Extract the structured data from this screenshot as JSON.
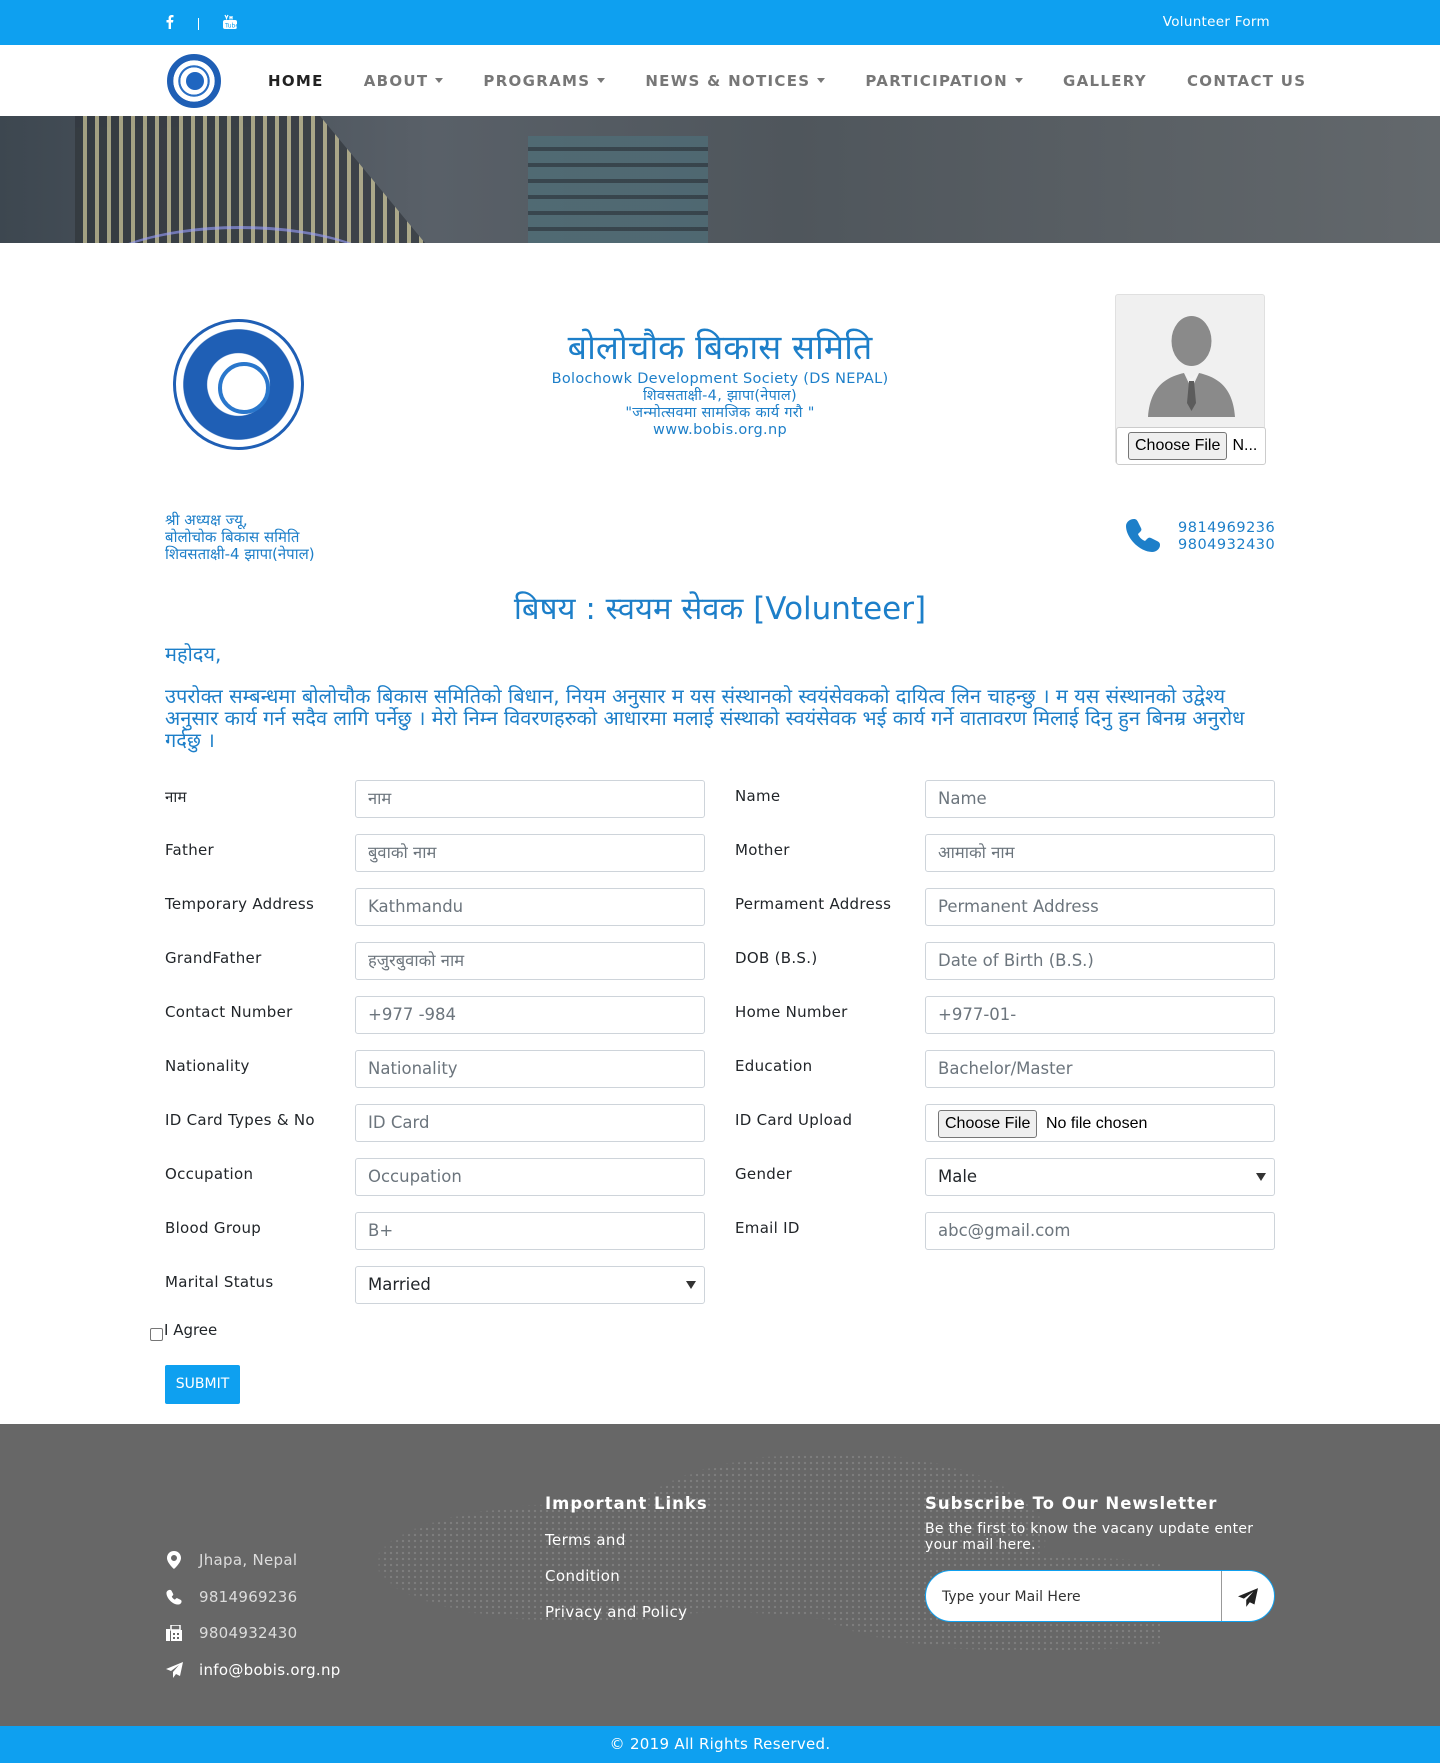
{
  "topbar": {
    "vol_form_link": "Volunteer Form",
    "social": [
      "facebook-icon",
      "youtube-icon"
    ]
  },
  "nav": {
    "items": [
      {
        "label": "HOME",
        "active": true,
        "dropdown": false
      },
      {
        "label": "ABOUT",
        "dropdown": true
      },
      {
        "label": "PROGRAMS",
        "dropdown": true
      },
      {
        "label": "NEWS & NOTICES",
        "dropdown": true
      },
      {
        "label": "PARTICIPATION",
        "dropdown": true
      },
      {
        "label": "GALLERY",
        "dropdown": false
      },
      {
        "label": "CONTACT US",
        "dropdown": false
      }
    ]
  },
  "letterhead": {
    "title_np": "बोलोचौक बिकास समिति",
    "name_en": "Bolochowk Development Society (DS NEPAL)",
    "address": "शिवसताक्षी-4, झापा(नेपाल)",
    "motto": "\"जन्मोत्सवमा सामजिक कार्य गरौ \"",
    "website": "www.bobis.org.np"
  },
  "photo_upload": {
    "button": "Choose File",
    "status": "N..."
  },
  "addressee": [
    "श्री अध्यक्ष ज्यू,",
    "बोलोचोक बिकास समिति",
    "शिवसताक्षी-4 झापा(नेपाल)"
  ],
  "phones": [
    "9814969236",
    "9804932430"
  ],
  "subject": "बिषय : स्वयम सेवक [Volunteer]",
  "salutation": "महोदय,",
  "paragraph": "उपरोक्त सम्बन्धमा बोलोचौक बिकास समितिको बिधान, नियम अनुसार म यस संस्थानको स्वयंसेवकको दायित्व लिन चाहन्छु । म यस संस्थानको उद्वेश्य अनुसार कार्य गर्न सदैव लागि पर्नेछु । मेरो निम्न विवरणहरुको आधारमा मलाई संस्थाको स्वयंसेवक भई कार्य गर्ने वातावरण मिलाई दिनु हुन बिनम्र अनुरोध गर्दछु ।",
  "form": {
    "left": [
      {
        "label": "नाम",
        "type": "text",
        "placeholder": "नाम"
      },
      {
        "label": "Father",
        "type": "text",
        "placeholder": "बुवाको नाम"
      },
      {
        "label": "Temporary Address",
        "type": "text",
        "placeholder": "Kathmandu"
      },
      {
        "label": "GrandFather",
        "type": "text",
        "placeholder": "हजुरबुवाको नाम"
      },
      {
        "label": "Contact Number",
        "type": "text",
        "placeholder": "+977 -984"
      },
      {
        "label": "Nationality",
        "type": "text",
        "placeholder": "Nationality"
      },
      {
        "label": "ID Card Types & No",
        "type": "text",
        "placeholder": "ID Card"
      },
      {
        "label": "Occupation",
        "type": "text",
        "placeholder": "Occupation"
      },
      {
        "label": "Blood Group",
        "type": "text",
        "placeholder": "B+"
      },
      {
        "label": "Marital Status",
        "type": "select",
        "value": "Married"
      }
    ],
    "right": [
      {
        "label": "Name",
        "type": "text",
        "placeholder": "Name"
      },
      {
        "label": "Mother",
        "type": "text",
        "placeholder": "आमाको नाम"
      },
      {
        "label": "Permament Address",
        "type": "text",
        "placeholder": "Permanent Address"
      },
      {
        "label": "DOB (B.S.)",
        "type": "text",
        "placeholder": "Date of Birth (B.S.)"
      },
      {
        "label": "Home Number",
        "type": "text",
        "placeholder": "+977-01-"
      },
      {
        "label": "Education",
        "type": "text",
        "placeholder": "Bachelor/Master"
      },
      {
        "label": "ID Card Upload",
        "type": "file",
        "button": "Choose File",
        "status": "No file chosen"
      },
      {
        "label": "Gender",
        "type": "select",
        "value": "Male"
      },
      {
        "label": "Email ID",
        "type": "text",
        "placeholder": "abc@gmail.com"
      }
    ],
    "agree_label": "I Agree",
    "submit_label": "SUBMIT"
  },
  "footer": {
    "contacts": [
      {
        "icon": "location-pin-icon",
        "text": "Jhapa, Nepal"
      },
      {
        "icon": "phone-icon",
        "text": "9814969236"
      },
      {
        "icon": "fax-icon",
        "text": "9804932430"
      },
      {
        "icon": "send-icon",
        "text": "info@bobis.org.np"
      }
    ],
    "links_heading": "Important Links",
    "links": [
      "Terms and",
      "Condition",
      "Privacy and Policy"
    ],
    "newsletter_heading": "Subscribe To Our Newsletter",
    "newsletter_text": "Be the first to know the vacany update enter your mail here.",
    "newsletter_placeholder": "Type your Mail Here",
    "copyright": "© 2019 All Rights Reserved."
  },
  "colors": {
    "accent": "#0ea0f0",
    "heading_blue": "#1d7fc9",
    "footer_bg": "#676767"
  }
}
